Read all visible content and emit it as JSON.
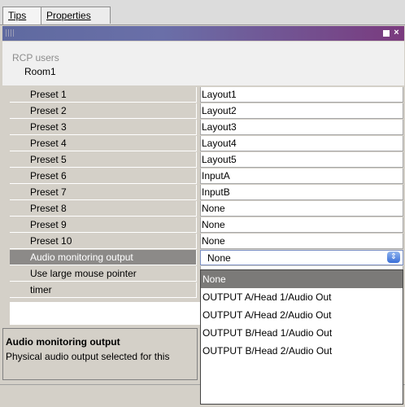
{
  "tabs": [
    {
      "label": "Tips"
    },
    {
      "label": "Properties"
    }
  ],
  "panel": {
    "close_glyph": "×"
  },
  "header": {
    "section": "RCP users",
    "name": "Room1"
  },
  "properties": [
    {
      "label": "Preset 1",
      "value": "Layout1"
    },
    {
      "label": "Preset 2",
      "value": "Layout2"
    },
    {
      "label": "Preset 3",
      "value": "Layout3"
    },
    {
      "label": "Preset 4",
      "value": "Layout4"
    },
    {
      "label": "Preset 5",
      "value": "Layout5"
    },
    {
      "label": "Preset 6",
      "value": "InputA"
    },
    {
      "label": "Preset 7",
      "value": "InputB"
    },
    {
      "label": "Preset 8",
      "value": "None"
    },
    {
      "label": "Preset 9",
      "value": "None"
    },
    {
      "label": "Preset 10",
      "value": "None"
    },
    {
      "label": "Audio monitoring output",
      "value": "None"
    },
    {
      "label": "Use large mouse pointer",
      "value": ""
    },
    {
      "label": "timer",
      "value": ""
    }
  ],
  "dropdown_arrow": "⇕",
  "dropdown": {
    "options": [
      "None",
      "OUTPUT A/Head 1/Audio Out",
      "OUTPUT A/Head 2/Audio Out",
      "OUTPUT B/Head 1/Audio Out",
      "OUTPUT B/Head 2/Audio Out"
    ],
    "highlighted": "None"
  },
  "description": {
    "title": "Audio monitoring output",
    "text": "Physical audio output selected for this"
  },
  "colors": {
    "titlebar_start": "#5f6aa0",
    "titlebar_end": "#7a3a7e",
    "selected_row": "#8c8a88",
    "dropdown_highlight": "#7b7a78"
  }
}
